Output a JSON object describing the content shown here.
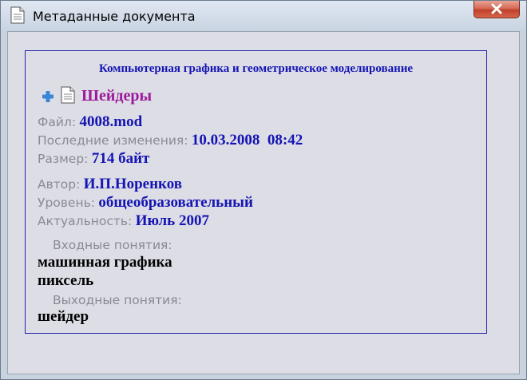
{
  "window": {
    "title": "Метаданные документа"
  },
  "document": {
    "course": "Компьютерная графика и геометрическое моделирование",
    "topic": "Шейдеры",
    "fields": {
      "file_label": "Файл:",
      "file_value": "4008.mod",
      "modified_label": "Последние изменения:",
      "modified_value": "10.03.2008  08:42",
      "size_label": "Размер:",
      "size_value": "714 байт",
      "author_label": "Автор:",
      "author_value": "И.П.Норенков",
      "level_label": "Уровень:",
      "level_value": "общеобразовательный",
      "relevance_label": "Актуальность:",
      "relevance_value": "Июль 2007"
    },
    "input_concepts_label": "Входные понятия:",
    "input_concepts": [
      "машинная графика",
      "пиксель"
    ],
    "output_concepts_label": "Выходные понятия:",
    "output_concepts": [
      "шейдер"
    ]
  },
  "icons": {
    "window": "document-icon",
    "close": "close-icon",
    "expand": "plus-icon",
    "topic": "page-icon"
  },
  "colors": {
    "accent_blue": "#1414b4",
    "topic_purple": "#9b1a9b",
    "label_gray": "#8a8a95",
    "close_red": "#c0402a"
  }
}
